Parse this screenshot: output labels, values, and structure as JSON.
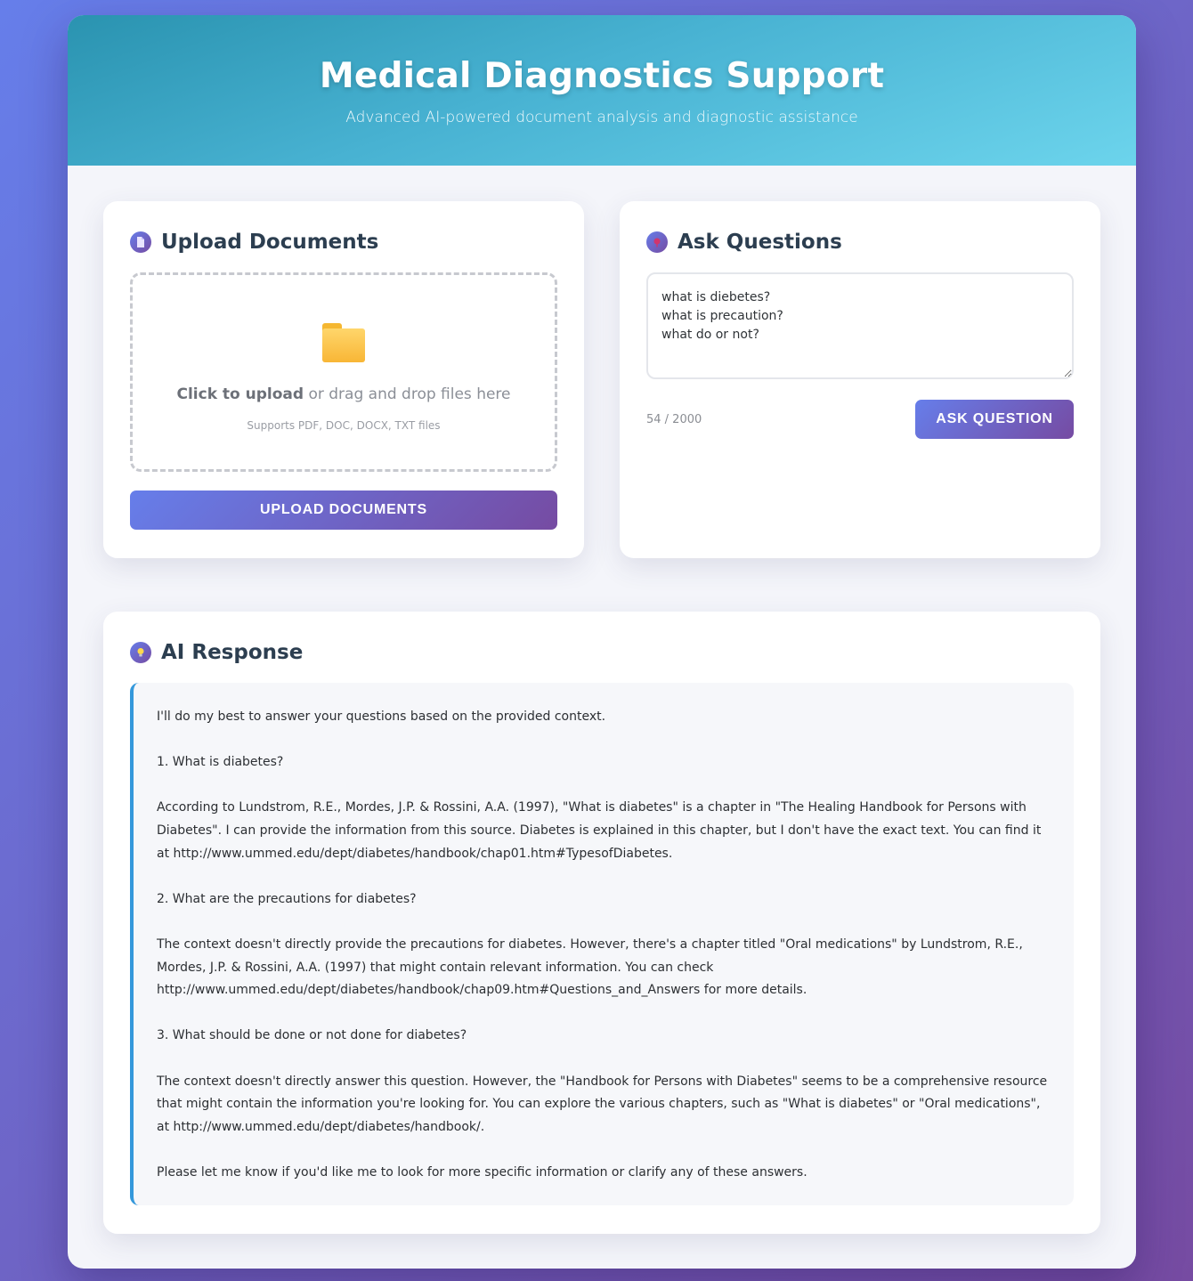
{
  "header": {
    "title": "Medical Diagnostics Support",
    "subtitle": "Advanced AI-powered document analysis and diagnostic assistance"
  },
  "upload": {
    "title": "Upload Documents",
    "icon": "document-icon",
    "folder_icon": "folder-icon",
    "drop_bold": "Click to upload",
    "drop_rest": " or drag and drop files here",
    "drop_sub": "Supports PDF, DOC, DOCX, TXT files",
    "button_label": "UPLOAD DOCUMENTS"
  },
  "ask": {
    "title": "Ask Questions",
    "icon": "question-icon",
    "question_value": "what is diebetes?\nwhat is precaution?\nwhat do or not?",
    "char_count": "54 / 2000",
    "button_label": "ASK QUESTION"
  },
  "response": {
    "title": "AI Response",
    "icon": "lightbulb-icon",
    "paragraphs": [
      "I'll do my best to answer your questions based on the provided context.",
      "1. What is diabetes?",
      "According to Lundstrom, R.E., Mordes, J.P. & Rossini, A.A. (1997), \"What is diabetes\" is a chapter in \"The Healing Handbook for Persons with Diabetes\". I can provide the information from this source. Diabetes is explained in this chapter, but I don't have the exact text. You can find it at http://www.ummed.edu/dept/diabetes/handbook/chap01.htm#TypesofDiabetes.",
      "2. What are the precautions for diabetes?",
      "The context doesn't directly provide the precautions for diabetes. However, there's a chapter titled \"Oral medications\" by Lundstrom, R.E., Mordes, J.P. & Rossini, A.A. (1997) that might contain relevant information. You can check http://www.ummed.edu/dept/diabetes/handbook/chap09.htm#Questions_and_Answers for more details.",
      "3. What should be done or not done for diabetes?",
      "The context doesn't directly answer this question. However, the \"Handbook for Persons with Diabetes\" seems to be a comprehensive resource that might contain the information you're looking for. You can explore the various chapters, such as \"What is diabetes\" or \"Oral medications\", at http://www.ummed.edu/dept/diabetes/handbook/.",
      "Please let me know if you'd like me to look for more specific information or clarify any of these answers."
    ]
  },
  "colors": {
    "accent_start": "#667eea",
    "accent_end": "#764ba2",
    "header_start": "#2a93b0",
    "header_end": "#6cd4ec",
    "response_border": "#3498db"
  }
}
